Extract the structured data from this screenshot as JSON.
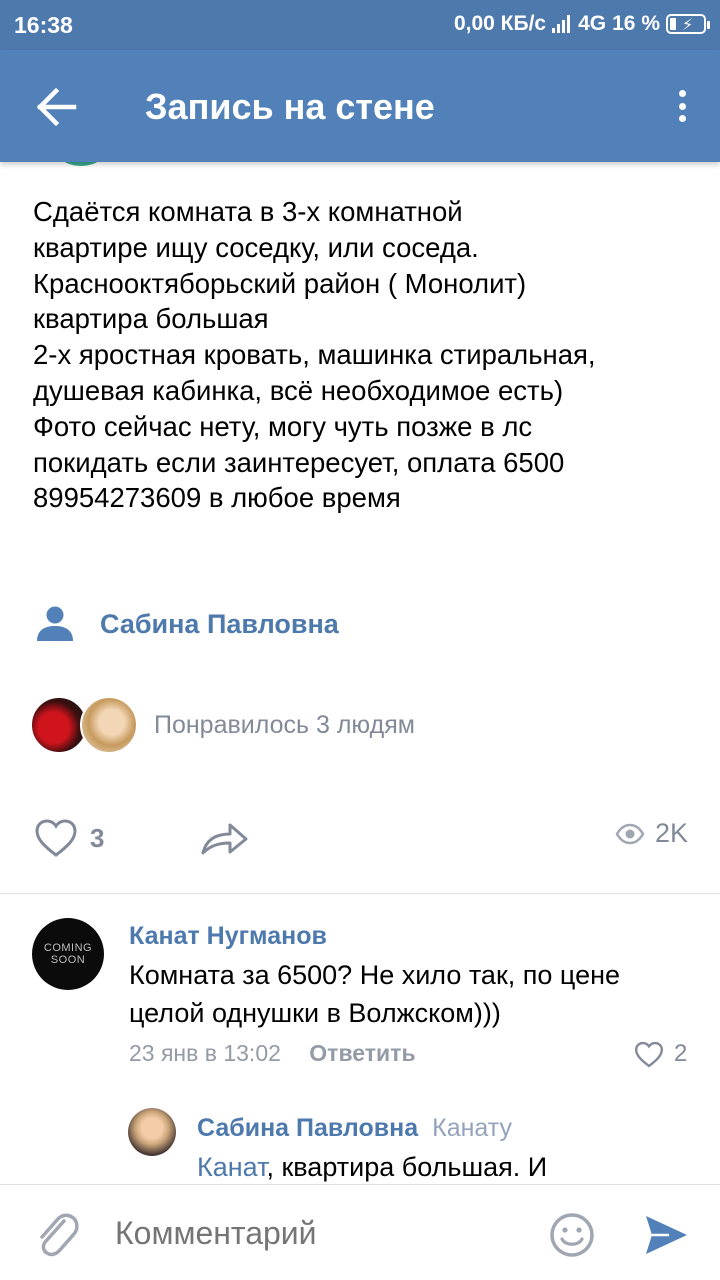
{
  "status_bar": {
    "time": "16:38",
    "speed": "0,00 КБ/с",
    "network": "4G",
    "battery": "16 %"
  },
  "toolbar": {
    "title": "Запись на стене",
    "back_icon": "arrow-left-icon",
    "menu_icon": "more-vertical-icon"
  },
  "post": {
    "text": "Сдаётся комната в 3-х комнатной\nквартире ищу соседку, или соседа.\nКраснооктяборьский район ( Монолит)\nквартира большая\n2-х яростная кровать, машинка стиральная,\nдушевая кабинка, всё необходимое есть)\nФото сейчас нету, могу чуть позже в лс\nпокидать если заинтересует, оплата 6500\n89954273609 в любое время",
    "author": "Сабина Павловна",
    "likes_text": "Понравилось 3 людям",
    "like_count": "3",
    "views_count": "2K"
  },
  "comments": [
    {
      "author": "Канат Нугманов",
      "avatar_text": "COMING SOON",
      "text": "Комната за 6500? Не хило так, по цене целой однушки в Волжском)))",
      "date": "23 янв в 13:02",
      "reply_label": "Ответить",
      "likes": "2"
    },
    {
      "author": "Сабина Павловна",
      "reply_to": "Канату",
      "mention": "Канат",
      "text": ", квартира большая. И"
    }
  ],
  "composer": {
    "placeholder": "Комментарий"
  },
  "colors": {
    "brand": "#5181b8",
    "link": "#4e79ad",
    "muted": "#828a99"
  }
}
